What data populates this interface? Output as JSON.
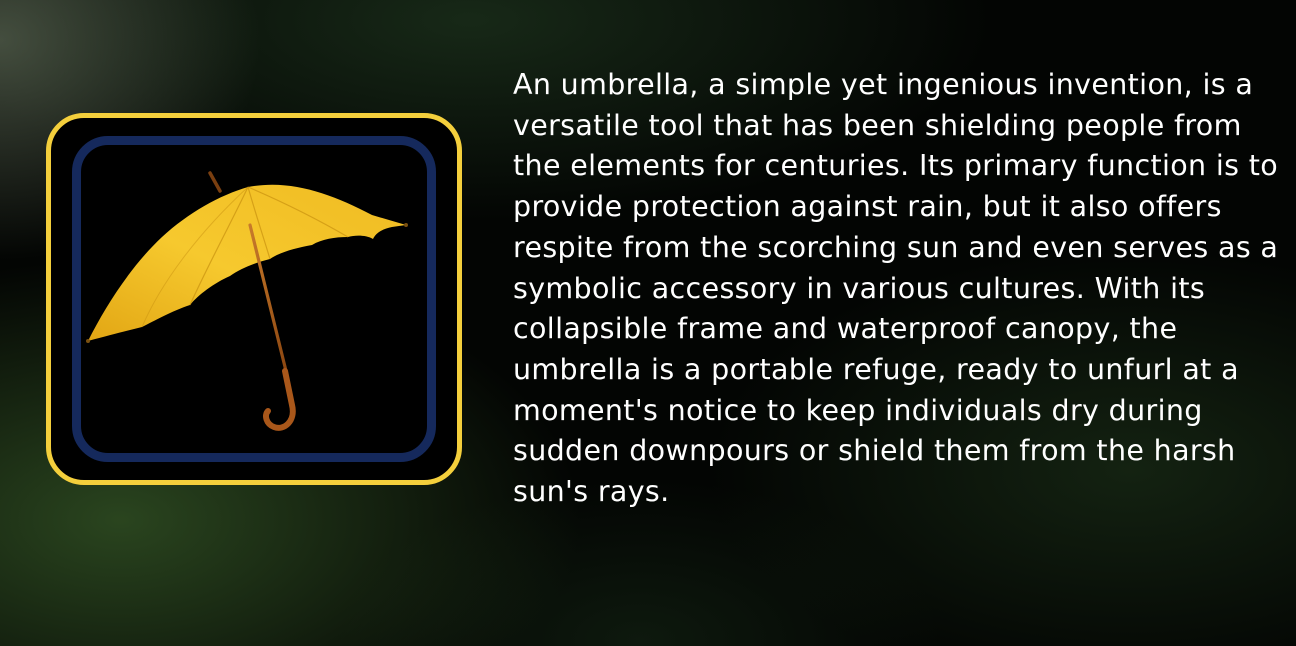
{
  "illustration": {
    "icon": "yellow-umbrella-icon",
    "colors": {
      "outer_frame": "#f4cf3c",
      "inner_frame": "#15295c",
      "canopy": "#f0c028",
      "handle": "#a55a14"
    }
  },
  "description": "An umbrella, a simple yet ingenious invention, is a versatile tool that has been shielding people from the elements for centuries. Its primary function is to provide protection against rain, but it also offers respite from the scorching sun and even serves as a symbolic accessory in various cultures. With its collapsible frame and waterproof canopy, the umbrella is a portable refuge, ready to unfurl at a moment's notice to keep individuals dry during sudden downpours or shield them from the harsh sun's rays."
}
